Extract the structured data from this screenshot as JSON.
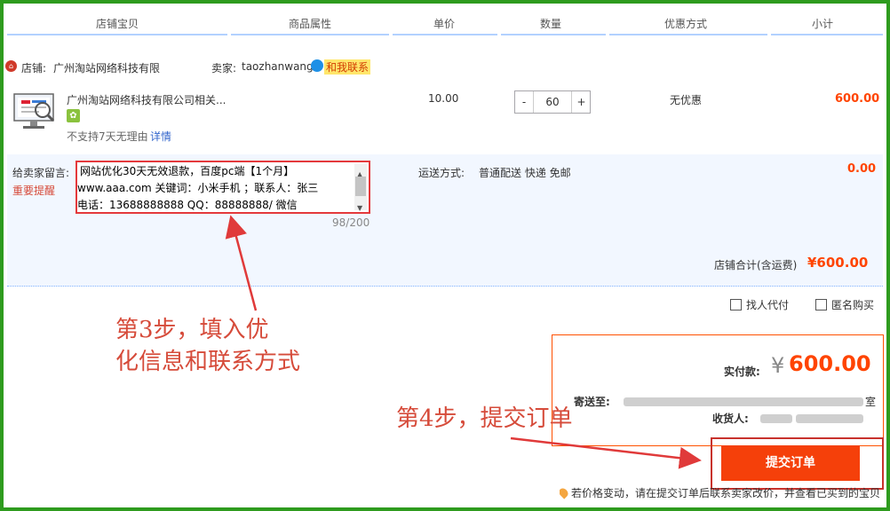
{
  "columns": [
    "店铺宝贝",
    "商品属性",
    "单价",
    "数量",
    "优惠方式",
    "小计"
  ],
  "shop": {
    "label": "店铺:",
    "name": "广州淘站网络科技有限",
    "seller_label": "卖家:",
    "seller": "taozhanwang",
    "contact": "和我联系"
  },
  "item": {
    "title": "广州淘站网络科技有限公司相关...",
    "no_return": "不支持7天无理由",
    "detail": "详情",
    "price": "10.00",
    "qty_minus": "-",
    "qty": "60",
    "qty_plus": "+",
    "discount": "无优惠",
    "subtotal": "600.00"
  },
  "message": {
    "label": "给卖家留言:",
    "important": "重要提醒",
    "line1": "网站优化30天无效退款，百度pc端【1个月】",
    "line2": "www.aaa.com  关键词：小米手机 ；联系人：张三",
    "line3": "电话：13688888888  QQ：88888888/ 微信",
    "count": "98/200",
    "ship_label": "运送方式:",
    "ship_value": "普通配送 快递 免邮",
    "ship_price": "0.00"
  },
  "total": {
    "label": "店铺合计(含运费)",
    "value": "¥600.00"
  },
  "options": {
    "proxy": "找人代付",
    "anonymous": "匿名购买"
  },
  "annotations": {
    "step3_line1": "第3步，填入优",
    "step3_line2": "化信息和联系方式",
    "step4": "第4步，提交订单"
  },
  "pay": {
    "label": "实付款:",
    "currency": "¥",
    "amount": "600.00",
    "send_label": "寄送至:",
    "send_value_end": "室",
    "receiver_label": "收货人:",
    "submit": "提交订单"
  },
  "notice": "若价格变动，请在提交订单后联系卖家改价，并查看已买到的宝贝",
  "colors": {
    "accent": "#ff4400",
    "frame": "#2e9b1e",
    "annotation": "#d64b3a"
  }
}
